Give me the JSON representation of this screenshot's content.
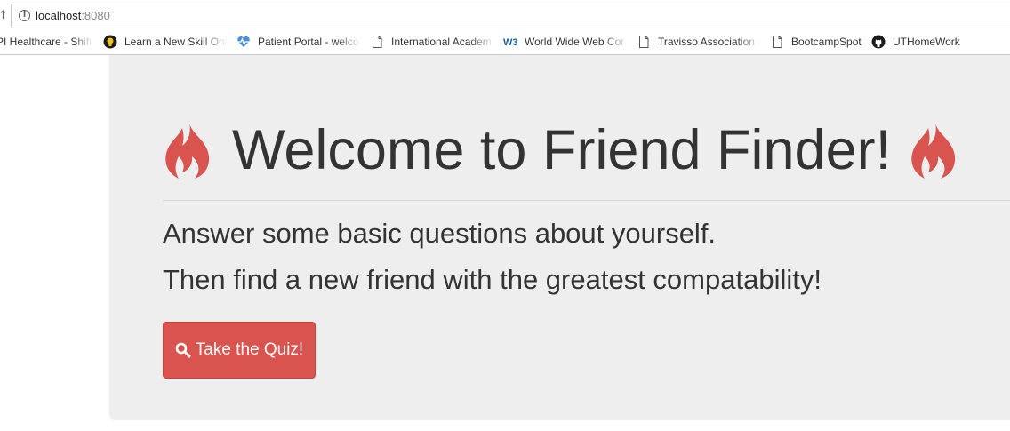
{
  "browser": {
    "url_host": "localhost",
    "url_port": ":8080",
    "bookmarks": [
      {
        "label": "PI Healthcare - Shift",
        "icon": "page-icon"
      },
      {
        "label": "Learn a New Skill Onl",
        "icon": "lightbulb-icon"
      },
      {
        "label": "Patient Portal - welco",
        "icon": "heart-pulse-icon"
      },
      {
        "label": "International Academ",
        "icon": "page-icon"
      },
      {
        "label": "World Wide Web Cor",
        "icon": "w3c-icon"
      },
      {
        "label": "Travisso Association -",
        "icon": "page-icon"
      },
      {
        "label": "BootcampSpot",
        "icon": "page-icon"
      },
      {
        "label": "UTHomeWork",
        "icon": "github-icon"
      }
    ]
  },
  "main": {
    "title": "Welcome to Friend Finder!",
    "lead_1": "Answer some basic questions about yourself.",
    "lead_2": "Then find a new friend with the greatest compatability!",
    "quiz_button_label": "Take the Quiz!",
    "flame_color": "#d9534f",
    "button_color": "#d9534f"
  }
}
